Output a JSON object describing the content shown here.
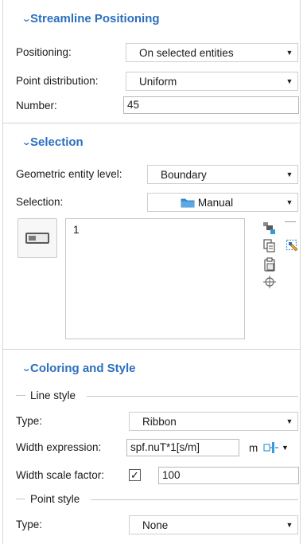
{
  "streamline_positioning": {
    "title": "Streamline Positioning",
    "positioning": {
      "label": "Positioning:",
      "value": "On selected entities"
    },
    "point_distribution": {
      "label": "Point distribution:",
      "value": "Uniform"
    },
    "number": {
      "label": "Number:",
      "value": "45"
    }
  },
  "selection": {
    "title": "Selection",
    "geometric_entity_level": {
      "label": "Geometric entity level:",
      "value": "Boundary"
    },
    "selection": {
      "label": "Selection:",
      "value": "Manual"
    },
    "items": [
      "1"
    ]
  },
  "coloring_style": {
    "title": "Coloring and Style",
    "line_style": {
      "group_label": "Line style",
      "type": {
        "label": "Type:",
        "value": "Ribbon"
      },
      "width_expression": {
        "label": "Width expression:",
        "value": "spf.nuT*1[s/m]",
        "unit": "m"
      },
      "width_scale_factor": {
        "label": "Width scale factor:",
        "checked": true,
        "check_glyph": "✓",
        "value": "100"
      }
    },
    "point_style": {
      "group_label": "Point style",
      "type": {
        "label": "Type:",
        "value": "None"
      }
    }
  },
  "glyphs": {
    "chevron": "⌄",
    "dropdown": "▼"
  },
  "icons": [
    "chevron-down-icon",
    "dropdown-arrow-icon",
    "folder-icon",
    "toggle-selection-icon",
    "zoom-to-selection-icon",
    "clear-selection-icon",
    "copy-selection-icon",
    "paste-selection-icon",
    "zoom-extents-icon",
    "unit-insert-icon"
  ]
}
